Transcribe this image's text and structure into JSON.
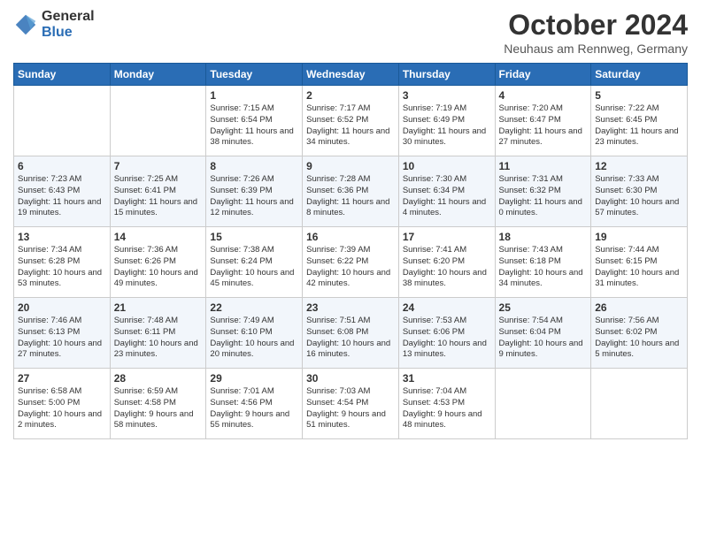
{
  "header": {
    "logo_general": "General",
    "logo_blue": "Blue",
    "month_title": "October 2024",
    "location": "Neuhaus am Rennweg, Germany"
  },
  "days_of_week": [
    "Sunday",
    "Monday",
    "Tuesday",
    "Wednesday",
    "Thursday",
    "Friday",
    "Saturday"
  ],
  "weeks": [
    [
      {
        "day": "",
        "info": ""
      },
      {
        "day": "",
        "info": ""
      },
      {
        "day": "1",
        "info": "Sunrise: 7:15 AM\nSunset: 6:54 PM\nDaylight: 11 hours and 38 minutes."
      },
      {
        "day": "2",
        "info": "Sunrise: 7:17 AM\nSunset: 6:52 PM\nDaylight: 11 hours and 34 minutes."
      },
      {
        "day": "3",
        "info": "Sunrise: 7:19 AM\nSunset: 6:49 PM\nDaylight: 11 hours and 30 minutes."
      },
      {
        "day": "4",
        "info": "Sunrise: 7:20 AM\nSunset: 6:47 PM\nDaylight: 11 hours and 27 minutes."
      },
      {
        "day": "5",
        "info": "Sunrise: 7:22 AM\nSunset: 6:45 PM\nDaylight: 11 hours and 23 minutes."
      }
    ],
    [
      {
        "day": "6",
        "info": "Sunrise: 7:23 AM\nSunset: 6:43 PM\nDaylight: 11 hours and 19 minutes."
      },
      {
        "day": "7",
        "info": "Sunrise: 7:25 AM\nSunset: 6:41 PM\nDaylight: 11 hours and 15 minutes."
      },
      {
        "day": "8",
        "info": "Sunrise: 7:26 AM\nSunset: 6:39 PM\nDaylight: 11 hours and 12 minutes."
      },
      {
        "day": "9",
        "info": "Sunrise: 7:28 AM\nSunset: 6:36 PM\nDaylight: 11 hours and 8 minutes."
      },
      {
        "day": "10",
        "info": "Sunrise: 7:30 AM\nSunset: 6:34 PM\nDaylight: 11 hours and 4 minutes."
      },
      {
        "day": "11",
        "info": "Sunrise: 7:31 AM\nSunset: 6:32 PM\nDaylight: 11 hours and 0 minutes."
      },
      {
        "day": "12",
        "info": "Sunrise: 7:33 AM\nSunset: 6:30 PM\nDaylight: 10 hours and 57 minutes."
      }
    ],
    [
      {
        "day": "13",
        "info": "Sunrise: 7:34 AM\nSunset: 6:28 PM\nDaylight: 10 hours and 53 minutes."
      },
      {
        "day": "14",
        "info": "Sunrise: 7:36 AM\nSunset: 6:26 PM\nDaylight: 10 hours and 49 minutes."
      },
      {
        "day": "15",
        "info": "Sunrise: 7:38 AM\nSunset: 6:24 PM\nDaylight: 10 hours and 45 minutes."
      },
      {
        "day": "16",
        "info": "Sunrise: 7:39 AM\nSunset: 6:22 PM\nDaylight: 10 hours and 42 minutes."
      },
      {
        "day": "17",
        "info": "Sunrise: 7:41 AM\nSunset: 6:20 PM\nDaylight: 10 hours and 38 minutes."
      },
      {
        "day": "18",
        "info": "Sunrise: 7:43 AM\nSunset: 6:18 PM\nDaylight: 10 hours and 34 minutes."
      },
      {
        "day": "19",
        "info": "Sunrise: 7:44 AM\nSunset: 6:15 PM\nDaylight: 10 hours and 31 minutes."
      }
    ],
    [
      {
        "day": "20",
        "info": "Sunrise: 7:46 AM\nSunset: 6:13 PM\nDaylight: 10 hours and 27 minutes."
      },
      {
        "day": "21",
        "info": "Sunrise: 7:48 AM\nSunset: 6:11 PM\nDaylight: 10 hours and 23 minutes."
      },
      {
        "day": "22",
        "info": "Sunrise: 7:49 AM\nSunset: 6:10 PM\nDaylight: 10 hours and 20 minutes."
      },
      {
        "day": "23",
        "info": "Sunrise: 7:51 AM\nSunset: 6:08 PM\nDaylight: 10 hours and 16 minutes."
      },
      {
        "day": "24",
        "info": "Sunrise: 7:53 AM\nSunset: 6:06 PM\nDaylight: 10 hours and 13 minutes."
      },
      {
        "day": "25",
        "info": "Sunrise: 7:54 AM\nSunset: 6:04 PM\nDaylight: 10 hours and 9 minutes."
      },
      {
        "day": "26",
        "info": "Sunrise: 7:56 AM\nSunset: 6:02 PM\nDaylight: 10 hours and 5 minutes."
      }
    ],
    [
      {
        "day": "27",
        "info": "Sunrise: 6:58 AM\nSunset: 5:00 PM\nDaylight: 10 hours and 2 minutes."
      },
      {
        "day": "28",
        "info": "Sunrise: 6:59 AM\nSunset: 4:58 PM\nDaylight: 9 hours and 58 minutes."
      },
      {
        "day": "29",
        "info": "Sunrise: 7:01 AM\nSunset: 4:56 PM\nDaylight: 9 hours and 55 minutes."
      },
      {
        "day": "30",
        "info": "Sunrise: 7:03 AM\nSunset: 4:54 PM\nDaylight: 9 hours and 51 minutes."
      },
      {
        "day": "31",
        "info": "Sunrise: 7:04 AM\nSunset: 4:53 PM\nDaylight: 9 hours and 48 minutes."
      },
      {
        "day": "",
        "info": ""
      },
      {
        "day": "",
        "info": ""
      }
    ]
  ]
}
